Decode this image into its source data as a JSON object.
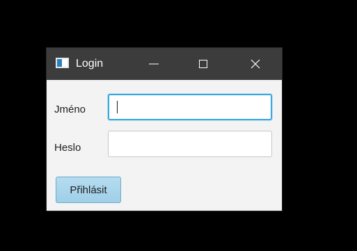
{
  "window": {
    "title": "Login",
    "icons": {
      "app": "java-app-icon",
      "minimize": "minimize-icon",
      "maximize": "maximize-icon",
      "close": "close-icon"
    }
  },
  "form": {
    "name_label": "Jméno",
    "name_value": "",
    "password_label": "Heslo",
    "password_value": "",
    "submit_label": "Přihlásit"
  },
  "colors": {
    "background": "#000000",
    "titlebar": "#3c3c3c",
    "window_body": "#f3f3f3",
    "focus_border": "#3aa6dc",
    "button": "#a8d5ec"
  }
}
